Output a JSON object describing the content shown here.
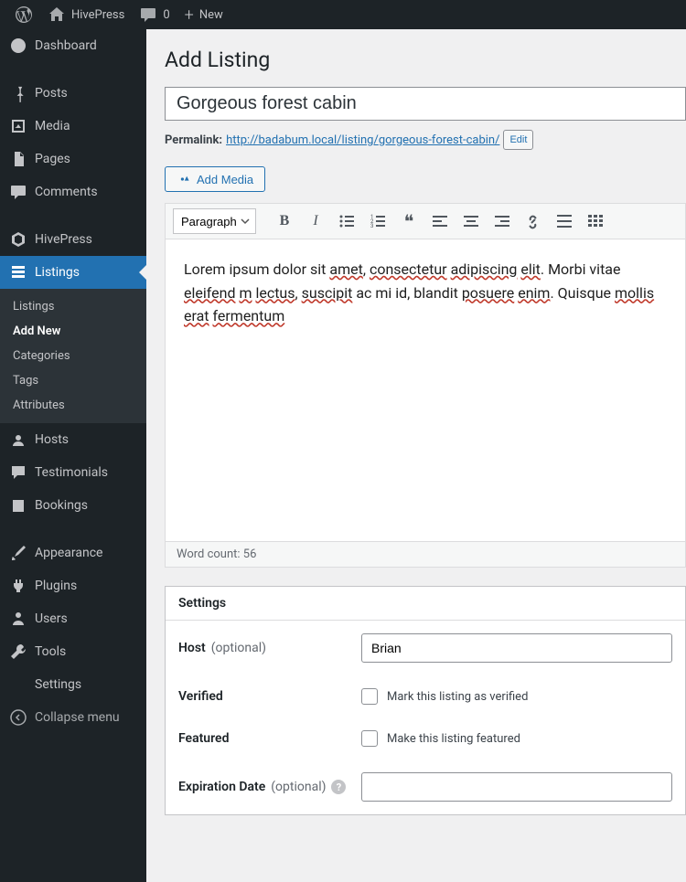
{
  "topbar": {
    "site_name": "HivePress",
    "comment_count": "0",
    "new_label": "New"
  },
  "sidebar": {
    "dashboard": "Dashboard",
    "posts": "Posts",
    "media": "Media",
    "pages": "Pages",
    "comments": "Comments",
    "hivepress": "HivePress",
    "listings": "Listings",
    "submenu": {
      "listings": "Listings",
      "add_new": "Add New",
      "categories": "Categories",
      "tags": "Tags",
      "attributes": "Attributes"
    },
    "hosts": "Hosts",
    "testimonials": "Testimonials",
    "bookings": "Bookings",
    "appearance": "Appearance",
    "plugins": "Plugins",
    "users": "Users",
    "tools": "Tools",
    "settings": "Settings",
    "collapse": "Collapse menu"
  },
  "page": {
    "title": "Add Listing",
    "title_input": "Gorgeous forest cabin",
    "permalink_label": "Permalink:",
    "permalink_base": "http://badabum.local/listing/",
    "permalink_slug": "gorgeous-forest-cabin/",
    "edit_label": "Edit",
    "add_media": "Add Media",
    "format_select": "Paragraph",
    "editor_html": "Lorem ipsum dolor sit <span class='sp'>amet</span>, <span class='sp'>consectetur</span> <span class='sp'>adipiscing</span> <span class='sp'>elit</span>. Morbi vitae <span class='sp'>eleifend</span> <span class='sp'>m</span> <span class='sp'>lectus</span>, <span class='sp'>suscipit</span> ac mi id, blandit <span class='sp'>posuere</span> <span class='sp'>enim</span>. Quisque <span class='sp'>mollis</span> <span class='sp'>erat</span> <span class='sp'>fermentum</span>",
    "word_count_label": "Word count: 56"
  },
  "settings": {
    "header": "Settings",
    "host_label": "Host",
    "optional": "(optional)",
    "host_value": "Brian",
    "verified_label": "Verified",
    "verified_desc": "Mark this listing as verified",
    "featured_label": "Featured",
    "featured_desc": "Make this listing featured",
    "expiration_label": "Expiration Date"
  }
}
